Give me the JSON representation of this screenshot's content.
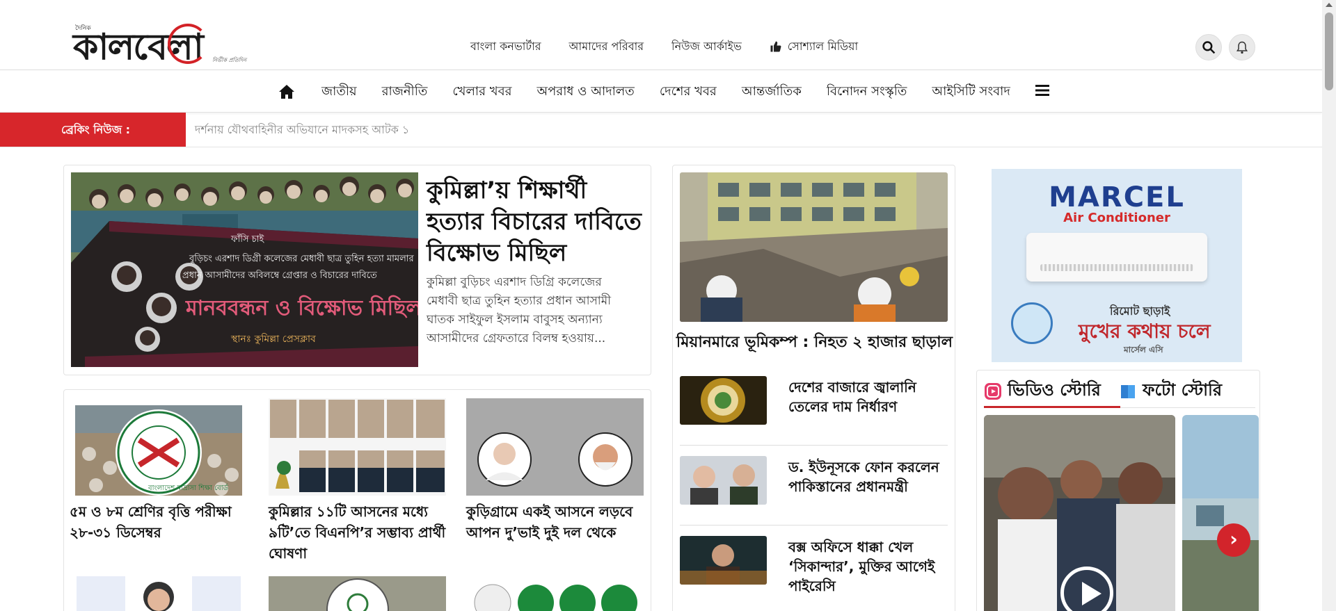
{
  "logo": {
    "small": "দৈনিক",
    "main": "কালবেলা",
    "tagline": "নির্ভীক প্রতিদিন"
  },
  "top_links": [
    {
      "label": "বাংলা কনভার্টার"
    },
    {
      "label": "আমাদের পরিবার"
    },
    {
      "label": "নিউজ আর্কাইভ"
    },
    {
      "label": "সোশ্যাল মিডিয়া",
      "icon": "thumbs-up-icon"
    }
  ],
  "header_icons": [
    "search-icon",
    "bell-icon"
  ],
  "nav": {
    "home_icon": "home-icon",
    "items": [
      "জাতীয়",
      "রাজনীতি",
      "খেলার খবর",
      "অপরাধ ও আদালত",
      "দেশের খবর",
      "আন্তর্জাতিক",
      "বিনোদন সংস্কৃতি",
      "আইসিটি সংবাদ"
    ],
    "menu_icon": "hamburger-menu-icon"
  },
  "breaking": {
    "label": "ব্রেকিং নিউজ :",
    "ticker": "দর্শনায় যৌথবাহিনীর অভিযানে মাদকসহ আটক ১"
  },
  "lead": {
    "title": "কুমিল্লা’য় শিক্ষার্থী হত্যার বিচারের দাবিতে বিক্ষোভ মিছিল",
    "summary": "কুমিল্লা বুড়িচং এরশাদ ডিগ্রি কলেজের মেধাবী ছাত্র তুহিন হত্যার প্রধান আসামী ঘাতক সাইফুল ইসলাম বাবুসহ অন্যান্য আসামীদের গ্রেফতারে বিলম্ব হওয়ায়...",
    "banner_lines": [
      "ফাঁসি চাই",
      "বুড়িচং এরশাদ ডিগ্রী কলেজের মেধাবী ছাত্র তুহিন হত্যা মামলার",
      "প্রধান আসামীদের অবিলম্বে গ্রেপ্তার ও বিচারের দাবিতে",
      "মানববন্ধন ও বিক্ষোভ মিছিল",
      "স্থানঃ কুমিল্লা প্রেসক্লাব"
    ]
  },
  "grid": [
    {
      "title": "৫ম ও ৮ম শ্রেণির বৃত্তি পরীক্ষা ২৮-৩১ ডিসেম্বর",
      "img_text": "বাংলাদেশ মাদ্রাসা শিক্ষা বোর্ড"
    },
    {
      "title": "কুমিল্লার ১১টি আসনের মধ্যে ৯টি’তে বিএনপি’র সম্ভাব্য প্রার্থী ঘোষণা"
    },
    {
      "title": "কুড়িগ্রামে একই আসনে লড়বে আপন দু’ভাই দুই দল থেকে"
    }
  ],
  "middle": {
    "hero_title": "মিয়ানমারে ভূমিকম্প : নিহত ২ হাজার ছাড়াল",
    "items": [
      {
        "title": "দেশের বাজারে জ্বালানি তেলের দাম নির্ধারণ"
      },
      {
        "title": "ড. ইউনূসকে ফোন করলেন পাকিস্তানের প্রধানমন্ত্রী"
      },
      {
        "title": "বক্স অফিসে ধাক্কা খেল ‘সিকান্দার’, মুক্তির আগেই পাইরেসি"
      }
    ]
  },
  "ad": {
    "brand": "MARCEL",
    "sub": "Air Conditioner",
    "line1": "রিমোট ছাড়াই",
    "line2": "মুখের কথায় চলে",
    "line3": "মার্সেল এসি"
  },
  "stories": {
    "tab_video": "ভিডিও স্টোরি",
    "tab_photo": "ফটো স্টোরি"
  },
  "colors": {
    "accent_red": "#d7262b",
    "text": "#111111",
    "muted": "#888888"
  }
}
